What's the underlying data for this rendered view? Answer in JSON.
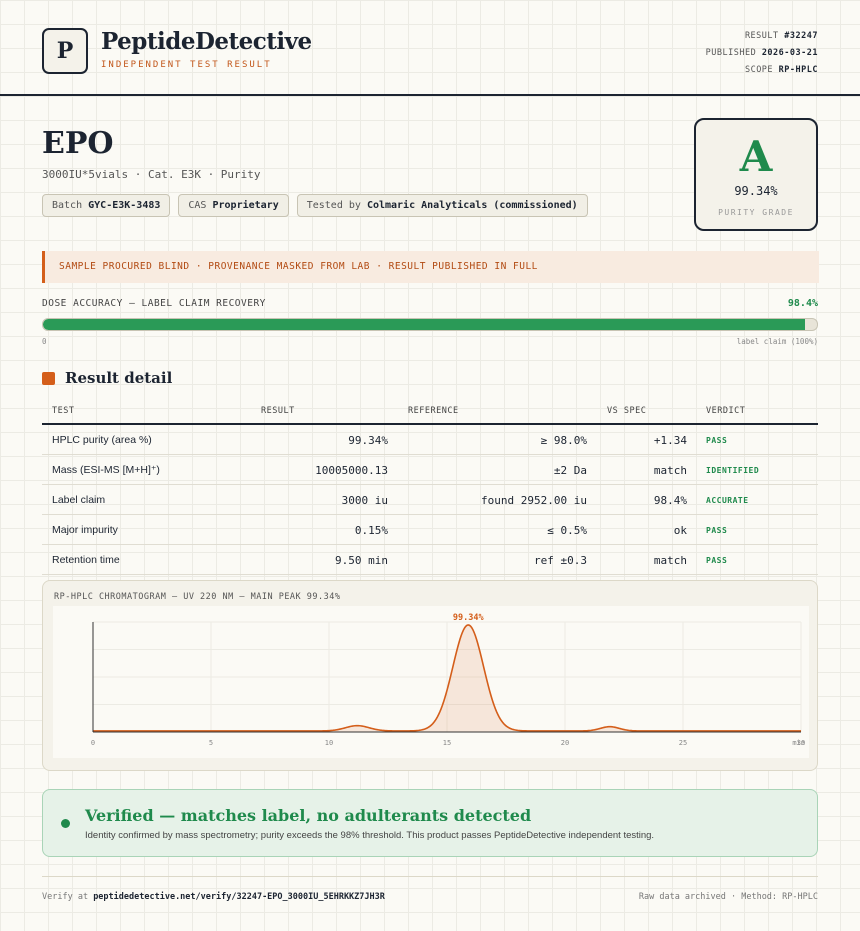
{
  "header": {
    "logo_letter": "P",
    "brand": "PeptideDetective",
    "subtitle": "INDEPENDENT TEST RESULT",
    "meta": {
      "result_label": "RESULT",
      "result_value": "#32247",
      "published_label": "PUBLISHED",
      "published_value": "2026-03-21",
      "scope_label": "SCOPE",
      "scope_value": "RP-HPLC"
    }
  },
  "product": {
    "name": "EPO",
    "subline": "3000IU*5vials · Cat. E3K · Purity",
    "pills": {
      "batch_label": "Batch",
      "batch_value": "GYC-E3K-3483",
      "cas_label": "CAS",
      "cas_value": "Proprietary",
      "tested_label": "Tested by",
      "tested_value": "Colmaric Analyticals (commissioned)"
    }
  },
  "grade": {
    "letter": "A",
    "value": "99.34%",
    "label": "PURITY GRADE",
    "color": "#1f8a4c"
  },
  "notice": "SAMPLE PROCURED BLIND · PROVENANCE MASKED FROM LAB · RESULT PUBLISHED IN FULL",
  "dose": {
    "label": "DOSE ACCURACY — LABEL CLAIM RECOVERY",
    "value_text": "98.4%",
    "fraction": 0.984,
    "min_label": "0",
    "max_label": "label claim (100%)"
  },
  "section_title": "Result detail",
  "table": {
    "headers": {
      "test": "TEST",
      "result": "RESULT",
      "reference": "REFERENCE",
      "vs": "VS SPEC",
      "verdict": "VERDICT"
    },
    "rows": [
      {
        "test": "HPLC purity (area %)",
        "result": "99.34%",
        "reference": "≥ 98.0%",
        "vs": "+1.34",
        "verdict": "PASS"
      },
      {
        "test": "Mass (ESI-MS [M+H]⁺)",
        "result": "10005000.13",
        "reference": "±2 Da",
        "vs": "match",
        "verdict": "IDENTIFIED"
      },
      {
        "test": "Label claim",
        "result": "3000 iu",
        "reference": "found 2952.00 iu",
        "vs": "98.4%",
        "verdict": "ACCURATE"
      },
      {
        "test": "Major impurity",
        "result": "0.15%",
        "reference": "≤ 0.5%",
        "vs": "ok",
        "verdict": "PASS"
      },
      {
        "test": "Retention time",
        "result": "9.50 min",
        "reference": "ref ±0.3",
        "vs": "match",
        "verdict": "PASS"
      }
    ]
  },
  "chromatogram": {
    "title": "RP-HPLC CHROMATOGRAM — UV 220 NM — MAIN PEAK 99.34%",
    "peak_label": "99.34%",
    "x_ticks": [
      "0",
      "5",
      "10",
      "15",
      "20",
      "25",
      "30"
    ],
    "x_unit": "min",
    "line_color": "#d45e1a"
  },
  "chart_data": {
    "type": "line",
    "title": "RP-HPLC CHROMATOGRAM — UV 220 NM — MAIN PEAK 99.34%",
    "xlabel": "min",
    "ylabel": "",
    "xlim": [
      0,
      30
    ],
    "x_ticks": [
      0,
      5,
      10,
      15,
      20,
      25,
      30
    ],
    "peaks": [
      {
        "x": 11.2,
        "height": 0.05,
        "width": 0.5
      },
      {
        "x": 15.9,
        "height": 1.0,
        "width": 0.65
      },
      {
        "x": 21.9,
        "height": 0.04,
        "width": 0.4
      }
    ],
    "baseline": 0.01,
    "annotations": [
      {
        "x": 15.9,
        "text": "99.34%"
      }
    ]
  },
  "verified": {
    "title": "Verified — matches label, no adulterants detected",
    "text": "Identity confirmed by mass spectrometry; purity exceeds the 98% threshold. This product passes PeptideDetective independent testing."
  },
  "footer": {
    "verify_prefix": "Verify at",
    "verify_url": "peptidedetective.net/verify/32247-EPO_3000IU_5EHRKKZ7JH3R",
    "right": "Raw data archived · Method: RP-HPLC"
  }
}
